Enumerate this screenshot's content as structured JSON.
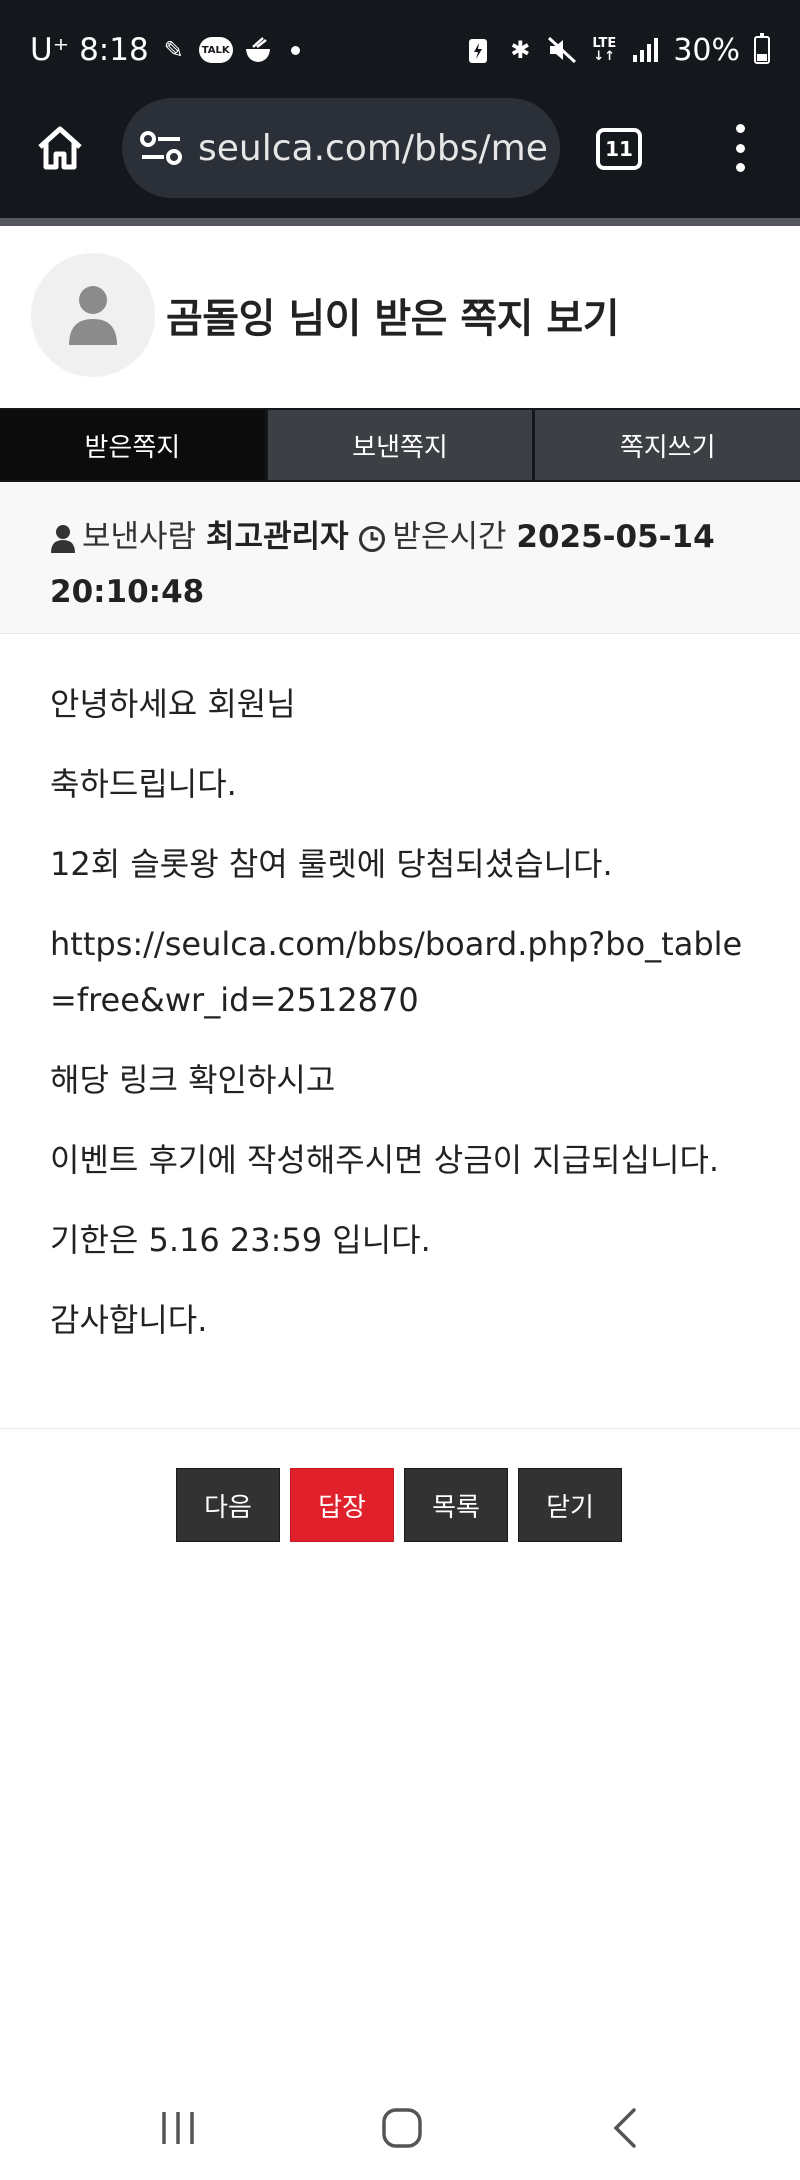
{
  "status_bar": {
    "carrier": "U⁺",
    "time": "8:18",
    "network": "LTE",
    "battery": "30%"
  },
  "browser": {
    "url": "seulca.com/bbs/memo_view.php",
    "tab_count": "11"
  },
  "header": {
    "title": "곰돌잉 님이 받은 쪽지 보기"
  },
  "tabs": [
    {
      "label": "받은쪽지",
      "active": true
    },
    {
      "label": "보낸쪽지",
      "active": false
    },
    {
      "label": "쪽지쓰기",
      "active": false
    }
  ],
  "meta": {
    "sender_label": "보낸사람",
    "sender_name": "최고관리자",
    "received_label": "받은시간",
    "received_time": "2025-05-14 20:10:48"
  },
  "message": {
    "lines": [
      "안녕하세요 회원님",
      "축하드립니다.",
      "12회 슬롯왕 참여 룰렛에 당첨되셨습니다.",
      "https://seulca.com/bbs/board.php?bo_table=free&wr_id=2512870",
      "해당 링크 확인하시고",
      "이벤트 후기에 작성해주시면 상금이 지급되십니다.",
      "기한은 5.16 23:59 입니다.",
      "감사합니다."
    ]
  },
  "buttons": {
    "next": "다음",
    "reply": "답장",
    "list": "목록",
    "close": "닫기"
  },
  "colors": {
    "dark": "#14171c",
    "accent_red": "#e0202a",
    "tab_inactive": "#3c3f44"
  }
}
